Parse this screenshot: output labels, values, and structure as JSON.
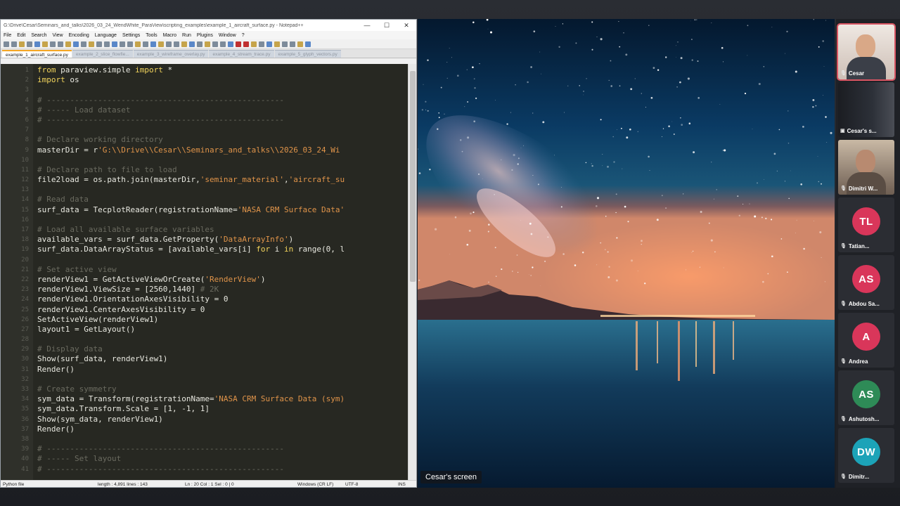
{
  "notepad": {
    "title": "G:\\Drive\\Cesar\\Seminars_and_talks\\2026_03_24_WendWhite_ParaView\\scripting_examples\\example_1_aircraft_surface.py - Notepad++",
    "window_buttons": [
      "—",
      "☐",
      "✕"
    ],
    "menu": [
      "File",
      "Edit",
      "Search",
      "View",
      "Encoding",
      "Language",
      "Settings",
      "Tools",
      "Macro",
      "Run",
      "Plugins",
      "Window",
      "?"
    ],
    "tabs": [
      {
        "label": "example_1_aircraft_surface.py",
        "active": true
      },
      {
        "label": "example_2_slice_flowfie...",
        "active": false
      },
      {
        "label": "example_3_wireframe_overlay.py",
        "active": false
      },
      {
        "label": "example_4_stream_trace.py",
        "active": false
      },
      {
        "label": "example_5_glyph_vectors.py",
        "active": false
      }
    ],
    "line_numbers": [
      "1",
      "2",
      "3",
      "4",
      "5",
      "6",
      "7",
      "8",
      "9",
      "10",
      "11",
      "12",
      "13",
      "14",
      "15",
      "16",
      "17",
      "18",
      "19",
      "20",
      "21",
      "22",
      "23",
      "24",
      "25",
      "26",
      "27",
      "28",
      "29",
      "30",
      "31",
      "32",
      "33",
      "34",
      "35",
      "36",
      "37",
      "38",
      "39",
      "40",
      "41"
    ],
    "code_lines": [
      "from paraview.simple import *",
      "import os",
      "",
      "# ---------------------------------------------------",
      "# ----- Load dataset",
      "# ---------------------------------------------------",
      "",
      "# Declare working directory",
      "masterDir = r'G:\\\\Drive\\\\Cesar\\\\Seminars_and_talks\\\\2026_03_24_Wi",
      "",
      "# Declare path to file to load",
      "file2load = os.path.join(masterDir,'seminar_material','aircraft_su",
      "",
      "# Read data",
      "surf_data = TecplotReader(registrationName='NASA CRM Surface Data'",
      "",
      "# Load all available surface variables",
      "available_vars = surf_data.GetProperty('DataArrayInfo')",
      "surf_data.DataArrayStatus = [available_vars[i] for i in range(0, l",
      "",
      "# Set active view",
      "renderView1 = GetActiveViewOrCreate('RenderView')",
      "renderView1.ViewSize = [2560,1440] # 2K",
      "renderView1.OrientationAxesVisibility = 0",
      "renderView1.CenterAxesVisibility = 0",
      "SetActiveView(renderView1)",
      "layout1 = GetLayout()",
      "",
      "# Display data",
      "Show(surf_data, renderView1)",
      "Render()",
      "",
      "# Create symmetry",
      "sym_data = Transform(registrationName='NASA CRM Surface Data (sym)",
      "sym_data.Transform.Scale = [1, -1, 1]",
      "Show(sym_data, renderView1)",
      "Render()",
      "",
      "# ---------------------------------------------------",
      "# ----- Set layout",
      "# ---------------------------------------------------"
    ],
    "status": {
      "lang": "Python file",
      "length": "length : 4,891    lines : 143",
      "pos": "Ln : 20    Col : 1    Sel : 0 | 0",
      "eol": "Windows (CR LF)",
      "enc": "UTF-8",
      "mode": "INS"
    }
  },
  "share": {
    "label": "Cesar's screen"
  },
  "participants": [
    {
      "name": "Cesar",
      "type": "video",
      "active": true
    },
    {
      "name": "Cesar's s...",
      "type": "screen",
      "active": false
    },
    {
      "name": "Dimitri W...",
      "type": "video",
      "active": false
    },
    {
      "name": "Tatian...",
      "initials": "TL",
      "color": "#d9365a",
      "type": "avatar",
      "active": false
    },
    {
      "name": "Abdou Sa...",
      "initials": "AS",
      "color": "#d9365a",
      "type": "avatar",
      "active": false
    },
    {
      "name": "Andrea",
      "initials": "A",
      "color": "#d9365a",
      "type": "avatar",
      "active": false
    },
    {
      "name": "Ashutosh...",
      "initials": "AS",
      "color": "#2e8b57",
      "type": "avatar",
      "active": false
    },
    {
      "name": "Dimitr...",
      "initials": "DW",
      "color": "#1ca3b8",
      "type": "avatar",
      "active": false
    }
  ]
}
